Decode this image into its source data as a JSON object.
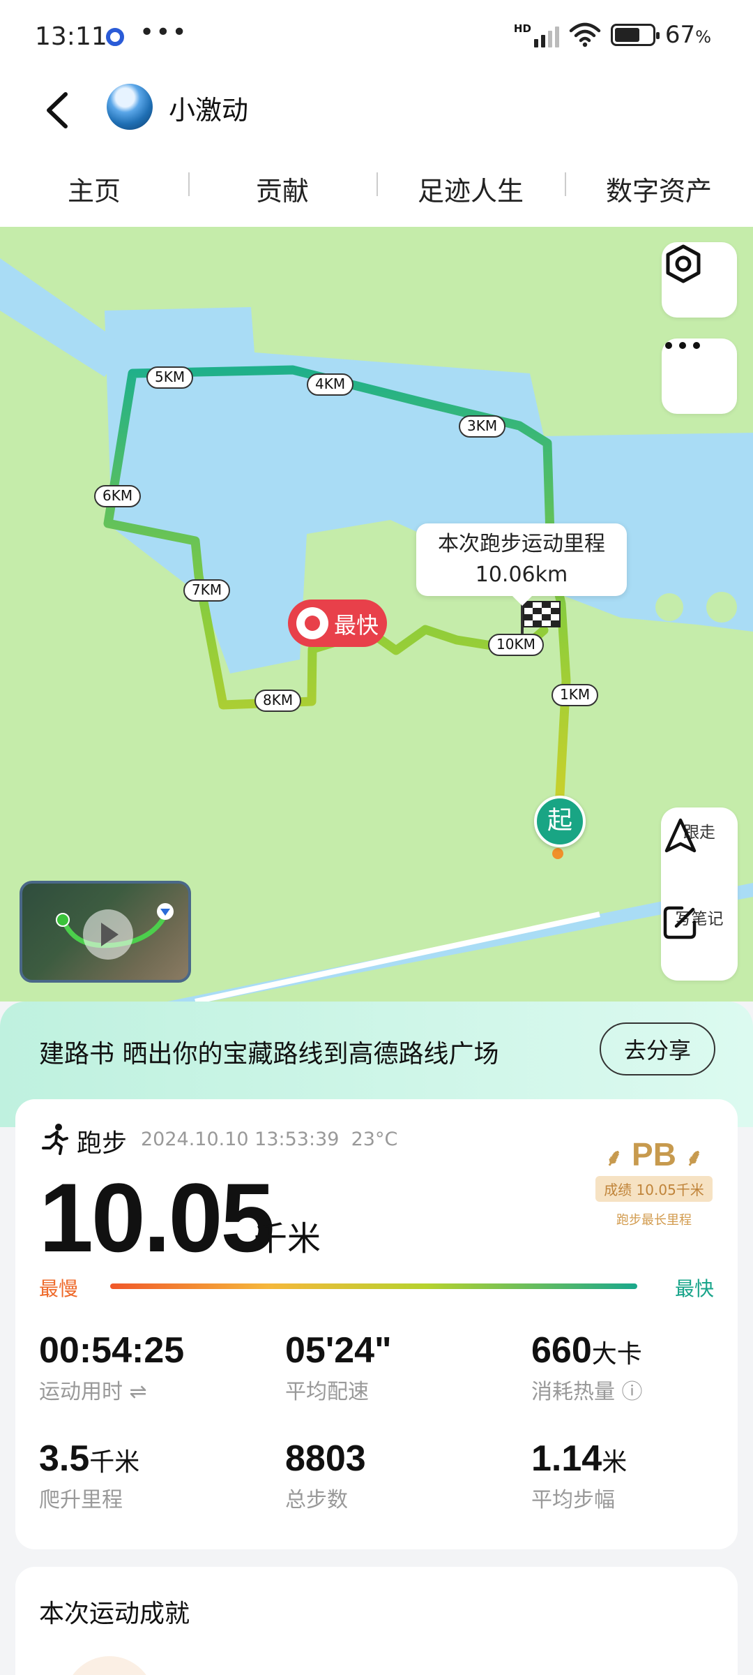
{
  "status_bar": {
    "time": "13:11",
    "battery": "67",
    "battery_unit": "%",
    "battery_level": 0.67,
    "network_label": "HD"
  },
  "header": {
    "title": "小激动"
  },
  "tabs": [
    "主页",
    "贡献",
    "足迹人生",
    "数字资产"
  ],
  "map": {
    "callout_line1": "本次跑步运动里程",
    "callout_line2": "10.06km",
    "fastest_label": "最快",
    "start_label": "起",
    "km_markers": [
      "5KM",
      "4KM",
      "3KM",
      "6KM",
      "7KM",
      "10KM",
      "1KM",
      "8KM"
    ],
    "follow_label": "跟走",
    "note_label": "写笔记"
  },
  "promo": {
    "text": "建路书 晒出你的宝藏路线到高德路线广场",
    "share_label": "去分享"
  },
  "run": {
    "type_label": "跑步",
    "datetime": "2024.10.10 13:53:39",
    "temperature": "23°C",
    "distance": "10.05",
    "distance_unit": "千米",
    "pb_title": "PB",
    "pb_badge": "成绩 10.05千米",
    "pb_sub": "跑步最长里程",
    "slowest_label": "最慢",
    "fastest_label": "最快"
  },
  "stats": [
    {
      "value": "00:54:25",
      "unit": "",
      "label": "运动用时 ⇌"
    },
    {
      "value": "05'24\"",
      "unit": "",
      "label": "平均配速"
    },
    {
      "value": "660",
      "unit": "大卡",
      "label": "消耗热量 ⓘ"
    },
    {
      "value": "3.5",
      "unit": "千米",
      "label": "爬升里程"
    },
    {
      "value": "8803",
      "unit": "",
      "label": "总步数"
    },
    {
      "value": "1.14",
      "unit": "米",
      "label": "平均步幅"
    }
  ],
  "achievements": {
    "title": "本次运动成就"
  },
  "colors": {
    "accent": "#19a584",
    "slow": "#ee6a2b",
    "fast": "#18a48a",
    "water": "#a9dcf5",
    "land": "#c5ecaa"
  }
}
